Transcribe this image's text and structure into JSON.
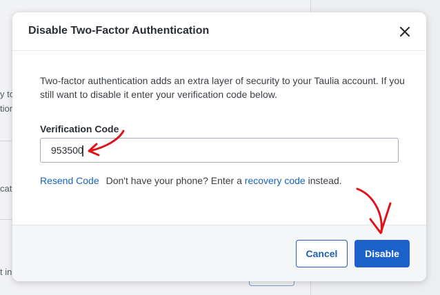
{
  "background": {
    "fragments": [
      "y to",
      "tion",
      "catio",
      "t in"
    ]
  },
  "modal": {
    "title": "Disable Two-Factor Authentication",
    "description": "Two-factor authentication adds an extra layer of security to your Taulia account. If you still want to disable it enter your verification code below.",
    "verification_label": "Verification Code",
    "verification_value": "953500",
    "resend_link": "Resend Code",
    "no_phone_text": "Don't have your phone? Enter a",
    "recovery_link": "recovery code",
    "instead_text": "instead.",
    "cancel_label": "Cancel",
    "disable_label": "Disable"
  },
  "colors": {
    "primary": "#1a62c7",
    "link": "#1565c0",
    "annotation": "#e0121a"
  },
  "icons": {
    "close": "close-icon"
  }
}
